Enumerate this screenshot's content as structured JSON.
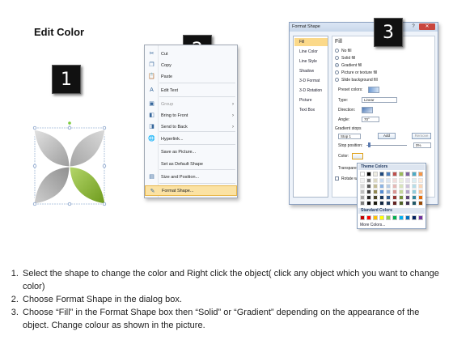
{
  "page_title": "Edit Color",
  "steps": [
    "1",
    "2",
    "3"
  ],
  "context_menu": {
    "items": [
      {
        "label": "Cut",
        "icon": "scissors-icon",
        "glyph": "✂",
        "disabled": false
      },
      {
        "label": "Copy",
        "icon": "copy-icon",
        "glyph": "❐",
        "disabled": false
      },
      {
        "label": "Paste",
        "icon": "paste-icon",
        "glyph": "📋",
        "disabled": false
      },
      {
        "label": "Edit Text",
        "icon": "edit-text-icon",
        "glyph": "A",
        "disabled": false
      },
      {
        "label": "Group",
        "icon": "group-icon",
        "glyph": "▣",
        "disabled": true,
        "submenu": true
      },
      {
        "label": "Bring to Front",
        "icon": "bring-to-front-icon",
        "glyph": "◧",
        "disabled": false,
        "submenu": true
      },
      {
        "label": "Send to Back",
        "icon": "send-to-back-icon",
        "glyph": "◨",
        "disabled": false,
        "submenu": true
      },
      {
        "label": "Hyperlink...",
        "icon": "hyperlink-icon",
        "glyph": "🌐",
        "disabled": false
      },
      {
        "label": "Save as Picture...",
        "icon": "",
        "glyph": "",
        "disabled": false
      },
      {
        "label": "Set as Default Shape",
        "icon": "",
        "glyph": "",
        "disabled": false
      },
      {
        "label": "Size and Position...",
        "icon": "size-position-icon",
        "glyph": "▤",
        "disabled": false
      },
      {
        "label": "Format Shape...",
        "icon": "format-shape-icon",
        "glyph": "✎",
        "disabled": false,
        "highlighted": true
      }
    ]
  },
  "dialog": {
    "title": "Format Shape",
    "close_glyph": "✕",
    "help_glyph": "?",
    "nav": [
      "Fill",
      "Line Color",
      "Line Style",
      "Shadow",
      "3-D Format",
      "3-D Rotation",
      "Picture",
      "Text Box"
    ],
    "heading": "Fill",
    "options": [
      "No fill",
      "Solid fill",
      "Gradient fill",
      "Picture or texture fill",
      "Slide background fill"
    ],
    "preset_label": "Preset colors:",
    "type_label": "Type:",
    "type_value": "Linear",
    "direction_label": "Direction:",
    "angle_label": "Angle:",
    "angle_value": "70°",
    "stops_label": "Gradient stops",
    "stop_value": "Stop 1",
    "add_label": "Add",
    "remove_label": "Remove",
    "stop_position_label": "Stop position:",
    "stop_position_value": "0%",
    "color_label": "Color:",
    "transparency_label": "Transparency:",
    "rotate_label": "Rotate with shape"
  },
  "color_popup": {
    "theme_label": "Theme Colors",
    "standard_label": "Standard Colors",
    "more_label": "More Colors...",
    "theme_top": [
      "#ffffff",
      "#000000",
      "#eeece1",
      "#1f497d",
      "#4f81bd",
      "#c0504d",
      "#9bbb59",
      "#8064a2",
      "#4bacc6",
      "#f79646"
    ],
    "theme_shades": [
      [
        "#f2f2f2",
        "#7f7f7f",
        "#ddd9c3",
        "#c6d9f0",
        "#dbe5f1",
        "#f2dcdb",
        "#ebf1dd",
        "#e5e0ec",
        "#dbeef3",
        "#fdeada"
      ],
      [
        "#d8d8d8",
        "#595959",
        "#c4bd97",
        "#8db3e2",
        "#b8cce4",
        "#e5b9b7",
        "#d7e3bc",
        "#ccc1d9",
        "#b7dde8",
        "#fbd5b5"
      ],
      [
        "#bfbfbf",
        "#3f3f3f",
        "#938953",
        "#548dd4",
        "#95b3d7",
        "#d99694",
        "#c3d69b",
        "#b2a2c7",
        "#92cddc",
        "#fac08f"
      ],
      [
        "#a5a5a5",
        "#262626",
        "#494429",
        "#17365d",
        "#366092",
        "#953734",
        "#76923c",
        "#5f497a",
        "#31859b",
        "#e36c09"
      ],
      [
        "#7f7f7f",
        "#0c0c0c",
        "#1d1b10",
        "#0f243e",
        "#244061",
        "#632423",
        "#4f6128",
        "#3f3151",
        "#205867",
        "#974806"
      ]
    ],
    "standard": [
      "#c00000",
      "#ff0000",
      "#ffc000",
      "#ffff00",
      "#92d050",
      "#00b050",
      "#00b0f0",
      "#0070c0",
      "#002060",
      "#7030a0"
    ]
  },
  "instructions": [
    "Select the shape to change the color and Right click the object( click any object which you want to change color)",
    "Choose Format Shape in the dialog box.",
    "Choose “Fill” in the Format Shape box then “Solid” or “Gradient” depending on the appearance of the object. Change colour as shown in the picture."
  ],
  "colors": {
    "accent_green": "#8ab833",
    "shape_gray": "#b8b8b8",
    "menu_highlight": "#fbe2a3"
  }
}
